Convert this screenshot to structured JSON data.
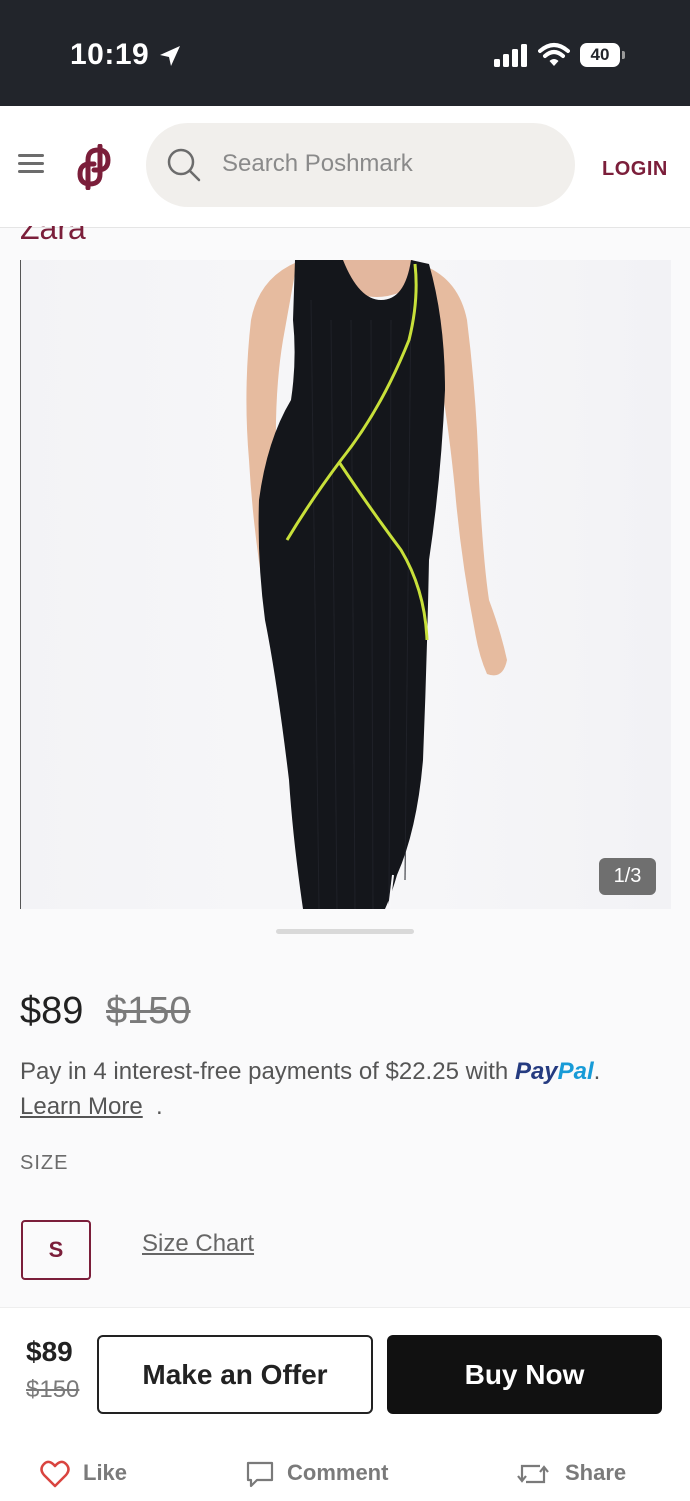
{
  "status_bar": {
    "time": "10:19",
    "battery": "40"
  },
  "header": {
    "search_placeholder": "Search Poshmark",
    "login_label": "LOGIN"
  },
  "listing": {
    "brand": "Zara",
    "image_counter": "1/3",
    "price": "$89",
    "original_price": "$150",
    "paypal": {
      "text": "Pay in 4 interest-free payments of $22.25 with ",
      "logo_pay": "Pay",
      "logo_pal": "Pal",
      "period": ".",
      "learn_more": "Learn More ",
      "learn_more_dot": "."
    },
    "size_heading": "SIZE",
    "size_value": "S",
    "size_chart_label": "Size Chart"
  },
  "bottom_bar": {
    "price": "$89",
    "original_price": "$150",
    "offer_label": "Make an Offer",
    "buy_label": "Buy Now",
    "like_label": "Like",
    "comment_label": "Comment",
    "share_label": "Share"
  },
  "colors": {
    "brand": "#7b1e3a",
    "dress": "#14161b",
    "piping": "#c8e03a"
  }
}
